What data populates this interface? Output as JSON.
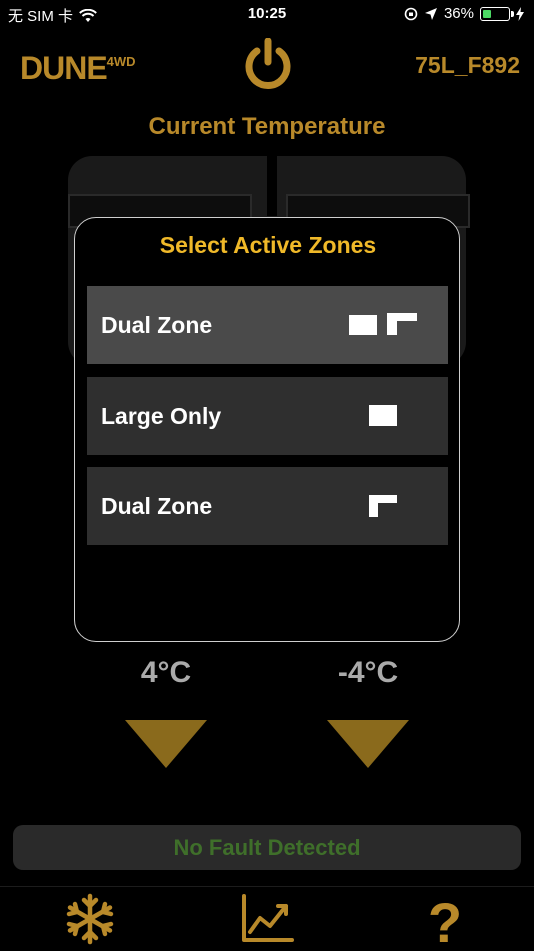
{
  "status_bar": {
    "carrier": "无 SIM 卡",
    "time": "10:25",
    "battery_percent": "36%",
    "battery_level": 0.36
  },
  "header": {
    "brand": "DUNE",
    "brand_sup": "4WD",
    "device_id": "75L_F892"
  },
  "current_temperature_label": "Current Temperature",
  "modal": {
    "title": "Select Active Zones",
    "options": [
      {
        "label": "Dual Zone",
        "selected": true
      },
      {
        "label": "Large Only",
        "selected": false
      },
      {
        "label": "Dual Zone",
        "selected": false
      }
    ]
  },
  "temperatures": {
    "left": "4°C",
    "right": "-4°C"
  },
  "fault_status": "No Fault Detected",
  "colors": {
    "brand_gold": "#b8892a",
    "title_yellow": "#f0b929",
    "fault_green": "#3f6f2a"
  },
  "tabs": [
    {
      "icon": "snowflake-icon"
    },
    {
      "icon": "chart-icon"
    },
    {
      "icon": "help-icon"
    }
  ]
}
